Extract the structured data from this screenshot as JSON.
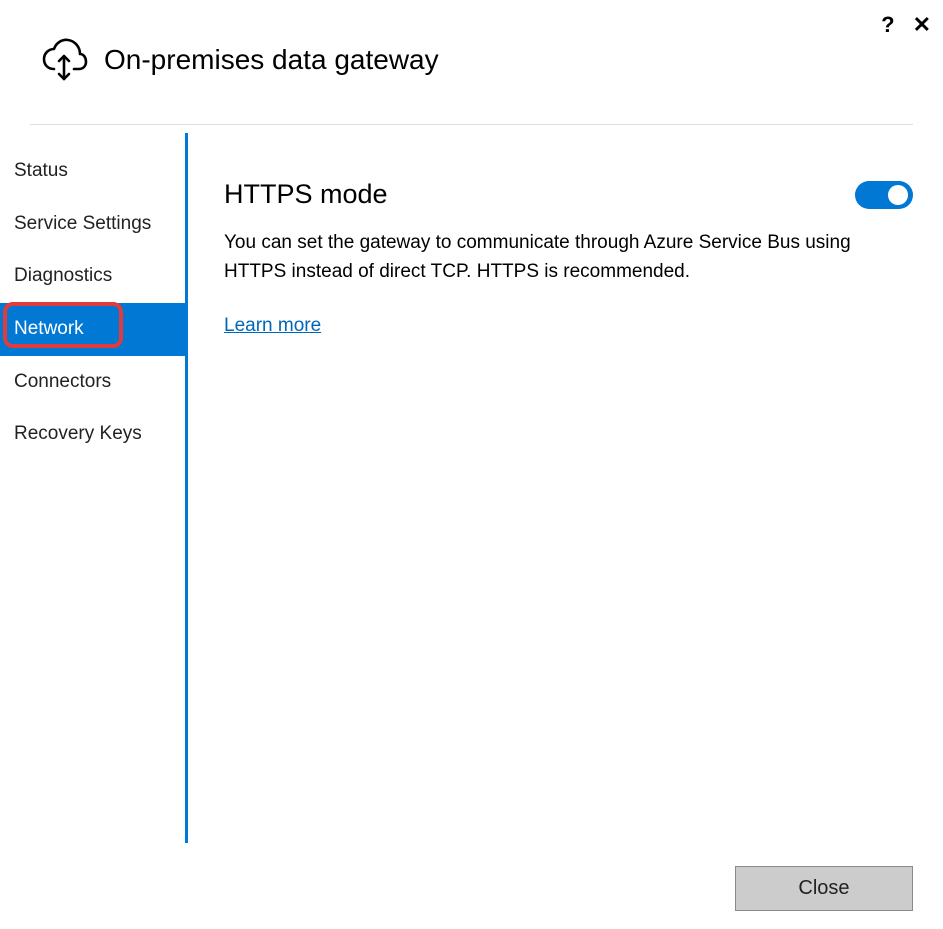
{
  "titlebar": {
    "help": "?",
    "close": "✕"
  },
  "header": {
    "title": "On-premises data gateway"
  },
  "sidebar": {
    "items": [
      {
        "label": "Status"
      },
      {
        "label": "Service Settings"
      },
      {
        "label": "Diagnostics"
      },
      {
        "label": "Network",
        "active": true,
        "highlighted": true
      },
      {
        "label": "Connectors"
      },
      {
        "label": "Recovery Keys"
      }
    ]
  },
  "main": {
    "section_title": "HTTPS mode",
    "toggle_state": "on",
    "description": "You can set the gateway to communicate through Azure Service Bus using HTTPS instead of direct TCP. HTTPS is recommended.",
    "learn_more_label": "Learn more"
  },
  "footer": {
    "close_label": "Close"
  }
}
